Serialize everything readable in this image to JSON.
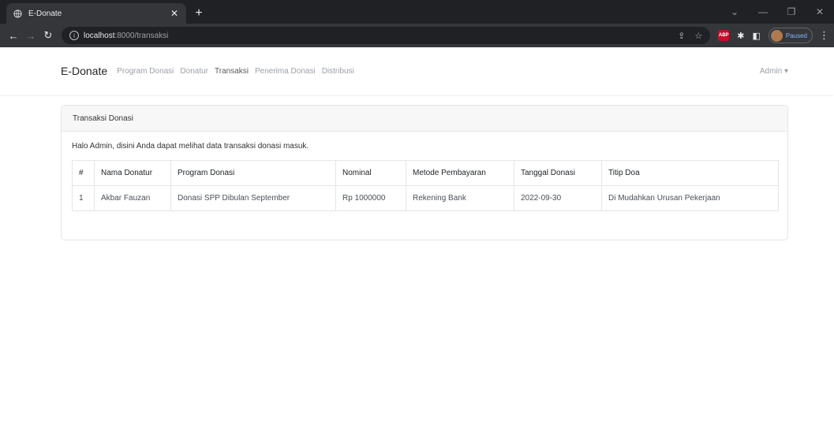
{
  "browser": {
    "tab_title": "E-Donate",
    "url_host": "localhost",
    "url_path": ":8000/transaksi",
    "profile_status": "Paused",
    "ext_label": "ABP"
  },
  "nav": {
    "brand": "E-Donate",
    "links": [
      "Program Donasi",
      "Donatur",
      "Transaksi",
      "Penerima Donasi",
      "Distribusi"
    ],
    "user": "Admin ▾"
  },
  "card": {
    "header": "Transaksi Donasi",
    "intro": "Halo Admin, disini Anda dapat melihat data transaksi donasi masuk."
  },
  "table": {
    "headers": [
      "#",
      "Nama Donatur",
      "Program Donasi",
      "Nominal",
      "Metode Pembayaran",
      "Tanggal Donasi",
      "Titip Doa"
    ],
    "rows": [
      [
        "1",
        "Akbar Fauzan",
        "Donasi SPP Dibulan September",
        "Rp 1000000",
        "Rekening Bank",
        "2022-09-30",
        "Di Mudahkan Urusan Pekerjaan"
      ]
    ]
  }
}
